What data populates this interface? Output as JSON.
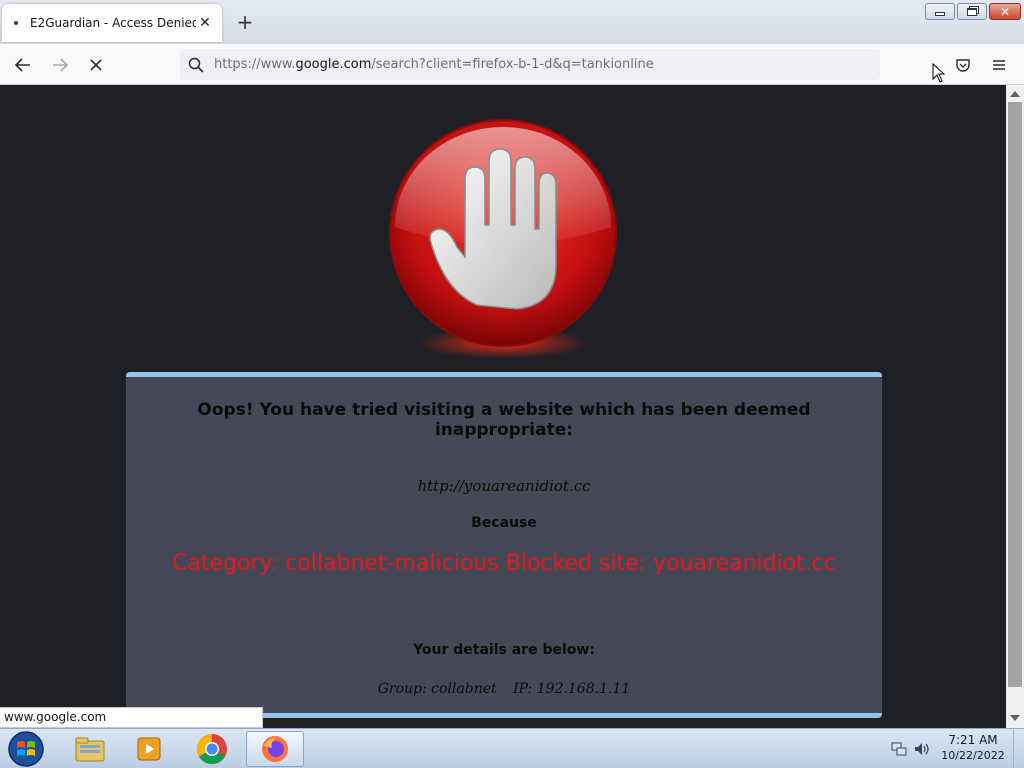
{
  "browser": {
    "tab": {
      "title": "E2Guardian - Access Denied",
      "close_label": "✕"
    },
    "new_tab_label": "+",
    "url": {
      "prefix": "https://www.",
      "host": "google.com",
      "suffix": "/search?client=firefox-b-1-d&q=tankionline"
    },
    "status_text": "www.google.com"
  },
  "page": {
    "heading": "Oops! You have tried visiting a website which has been deemed inappropriate:",
    "blocked_url": "http://youareanidiot.cc",
    "because_label": "Because",
    "reason": "Category: collabnet-malicious  Blocked site: youareanidiot.cc",
    "details_heading": "Your details are below:",
    "group_text": "Group: collabnet",
    "ip_text": "IP: 192.168.1.11"
  },
  "taskbar": {
    "items": [
      "start-button",
      "windows-explorer",
      "media-player",
      "google-chrome",
      "firefox"
    ],
    "clock": {
      "time": "7:21 AM",
      "date": "10/22/2022"
    }
  },
  "colors": {
    "page_background": "#1e2026",
    "panel_background": "#454957",
    "panel_border": "#93c3ea",
    "reason_text": "#e81818",
    "stop_sign_red": "#d01818"
  }
}
